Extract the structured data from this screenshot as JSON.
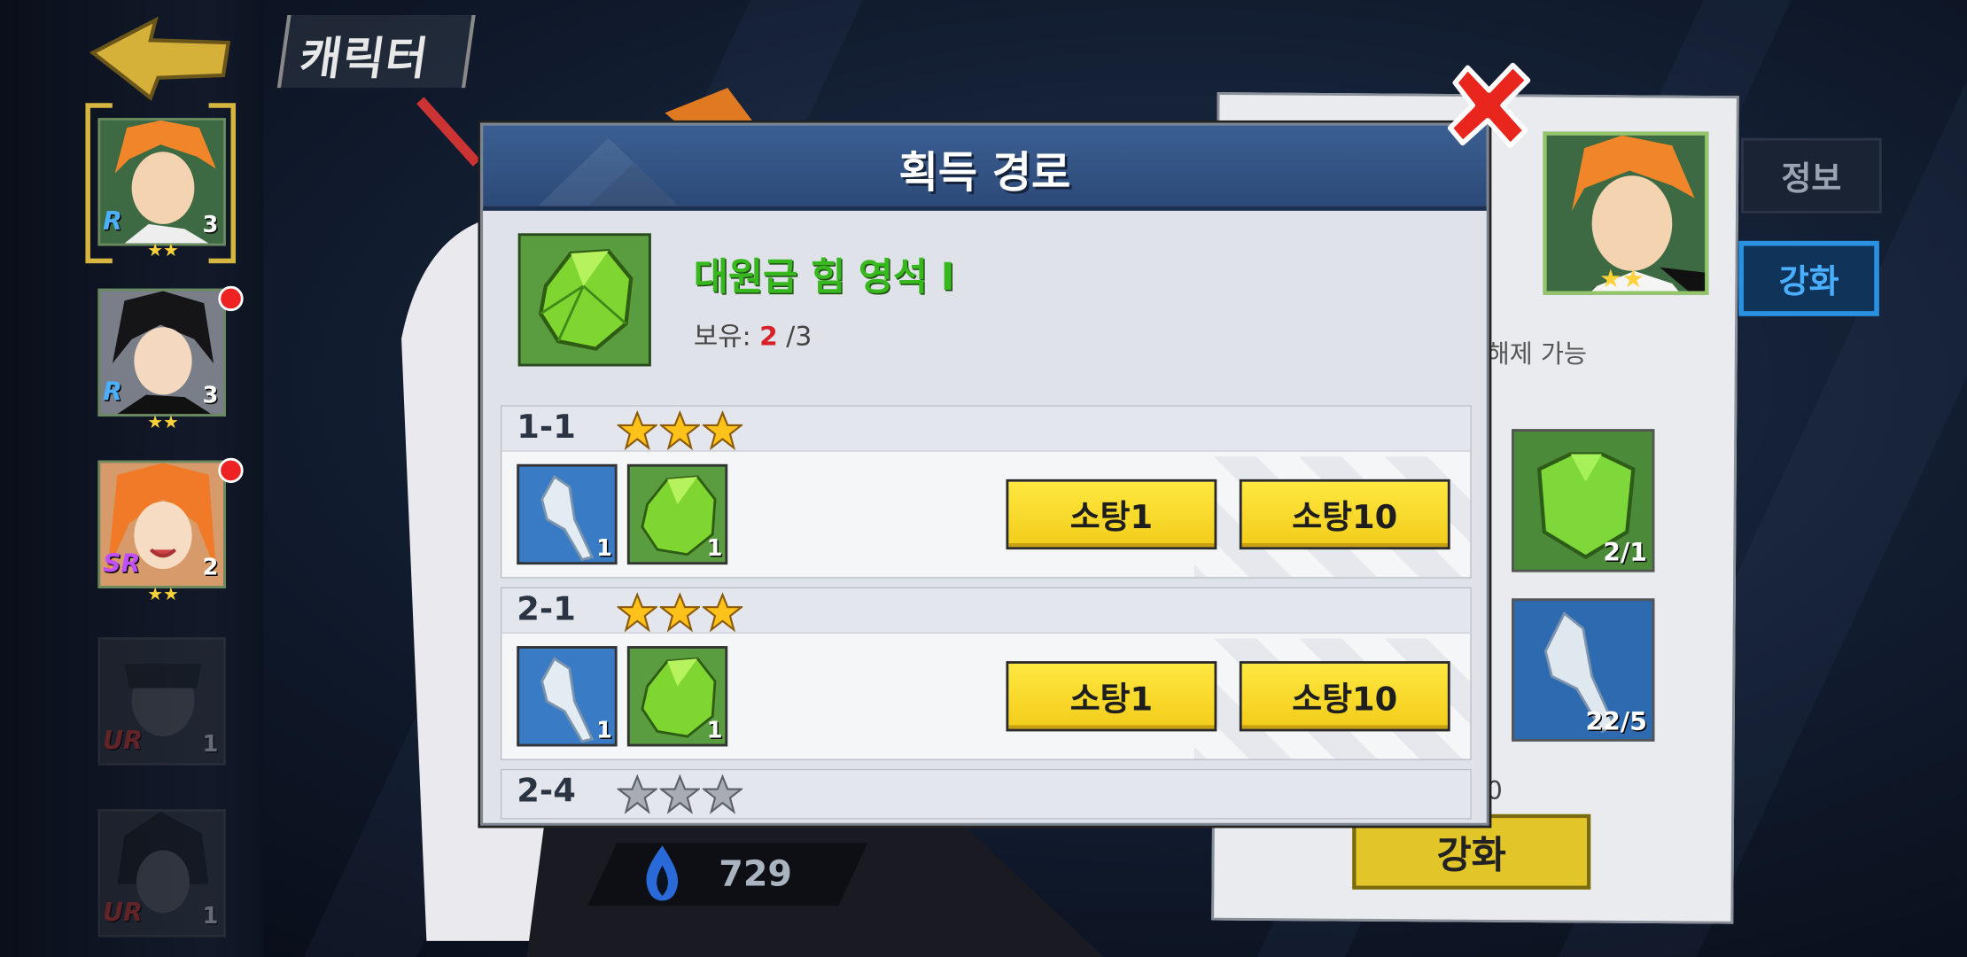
{
  "screen": {
    "title": "캐릭터"
  },
  "sidebar": {
    "characters": [
      {
        "rarity": "R",
        "level": "3",
        "stars": "★★",
        "has_alert": false,
        "selected": true
      },
      {
        "rarity": "R",
        "level": "3",
        "stars": "★★",
        "has_alert": true,
        "selected": false
      },
      {
        "rarity": "SR",
        "level": "2",
        "stars": "★★",
        "has_alert": true,
        "selected": false
      },
      {
        "rarity": "UR",
        "level": "1",
        "stars": "",
        "has_alert": false,
        "locked": true
      },
      {
        "rarity": "UR",
        "level": "1",
        "stars": "",
        "has_alert": false,
        "locked": true
      }
    ]
  },
  "background_panel": {
    "tabs": {
      "info": "정보",
      "upgrade": "강화"
    },
    "unlock_text": "해제 가능",
    "materials": [
      {
        "count": "2/1"
      },
      {
        "count": "22/5"
      }
    ],
    "partial_value": "0",
    "enhance_button": "강화",
    "power": "729",
    "stars": "★★"
  },
  "modal": {
    "title": "획득 경로",
    "item": {
      "name": "대원급 힘 영석 Ⅰ",
      "owned_label": "보유:",
      "owned_current": "2",
      "owned_total": "/3"
    },
    "stages": [
      {
        "label": "1-1",
        "stars_earned": 3,
        "rewards": [
          {
            "icon": "figure-icon",
            "count": "1"
          },
          {
            "icon": "green-crystal-icon",
            "count": "1"
          }
        ],
        "sweep1": "소탕1",
        "sweep10": "소탕10"
      },
      {
        "label": "2-1",
        "stars_earned": 3,
        "rewards": [
          {
            "icon": "figure-icon",
            "count": "1"
          },
          {
            "icon": "green-crystal-icon",
            "count": "1"
          }
        ],
        "sweep1": "소탕1",
        "sweep10": "소탕10"
      },
      {
        "label": "2-4",
        "stars_earned": 0
      }
    ]
  },
  "colors": {
    "accent_yellow": "#f2cc1a",
    "header_blue": "#2c4a78",
    "item_green": "#37b81e",
    "owned_red": "#d8202a"
  }
}
